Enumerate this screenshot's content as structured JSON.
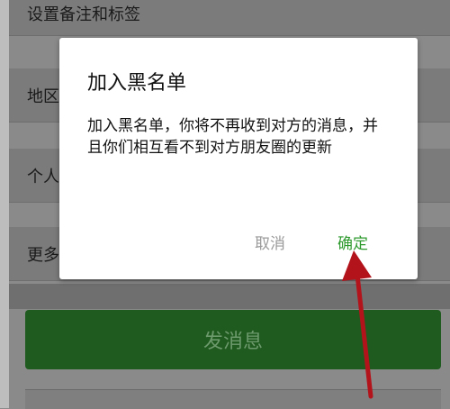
{
  "background": {
    "rows": [
      {
        "label": "设置备注和标签"
      },
      {
        "label": "地区"
      },
      {
        "label": "个人"
      },
      {
        "label": "更多"
      }
    ],
    "send_button_label": "发消息"
  },
  "dialog": {
    "title": "加入黑名单",
    "message": "加入黑名单，你将不再收到对方的消息，并且你们相互看不到对方朋友圈的更新",
    "cancel_label": "取消",
    "confirm_label": "确定"
  },
  "colors": {
    "confirm": "#2e9a2e",
    "cancel": "#9a9a9a",
    "annotation_arrow": "#b3141c",
    "send_button": "#1f5a1f"
  }
}
